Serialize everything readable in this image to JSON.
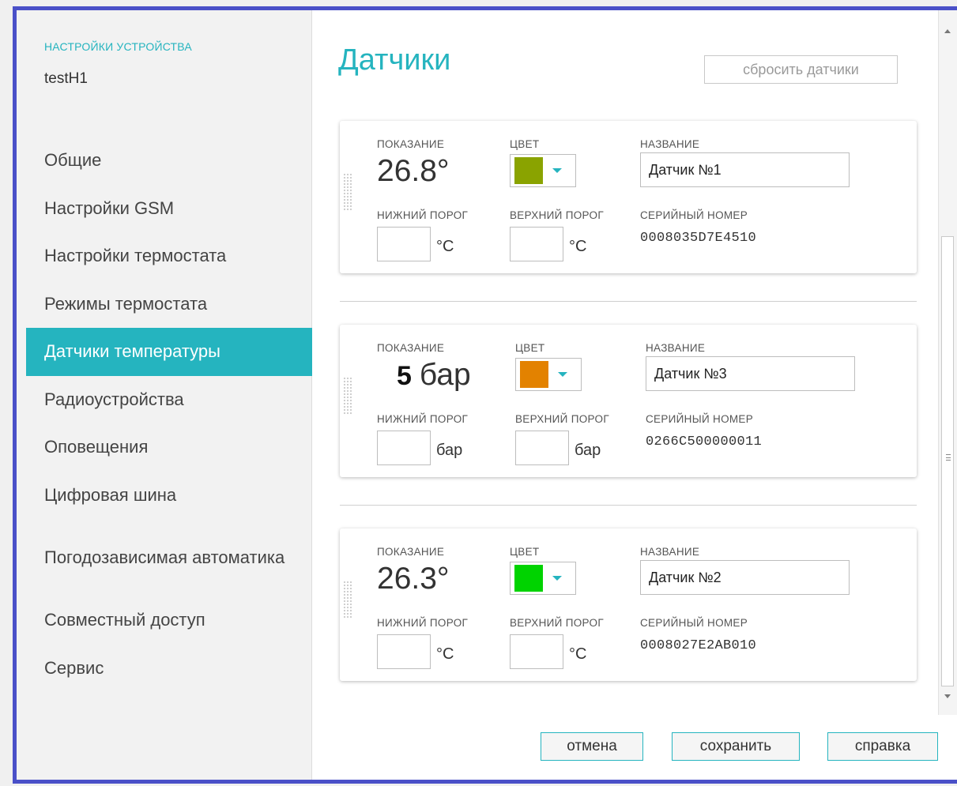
{
  "sidebar": {
    "section_label": "НАСТРОЙКИ УСТРОЙСТВА",
    "device_name": "testH1",
    "items": [
      {
        "label": "Общие"
      },
      {
        "label": "Настройки GSM"
      },
      {
        "label": "Настройки термостата"
      },
      {
        "label": "Режимы термостата"
      },
      {
        "label": "Датчики температуры",
        "active": true
      },
      {
        "label": "Радиоустройства"
      },
      {
        "label": "Оповещения"
      },
      {
        "label": "Цифровая шина"
      },
      {
        "label": "Погодозависимая автоматика"
      },
      {
        "label": "Совместный доступ"
      },
      {
        "label": "Сервис"
      }
    ]
  },
  "main": {
    "title": "Датчики",
    "reset_button": "сбросить датчики"
  },
  "labels": {
    "reading": "ПОКАЗАНИЕ",
    "color": "ЦВЕТ",
    "name": "НАЗВАНИЕ",
    "low": "НИЖНИЙ ПОРОГ",
    "high": "ВЕРХНИЙ ПОРОГ",
    "serial": "СЕРИЙНЫЙ НОМЕР"
  },
  "sensors": [
    {
      "reading": "26.8°",
      "color": "#8aa300",
      "name": "Датчик №1",
      "unit": "°C",
      "serial": "0008035D7E4510",
      "low": "",
      "high": ""
    },
    {
      "reading_value": "5",
      "reading_unit": "бар",
      "color": "#e38200",
      "name": "Датчик №3",
      "unit": "бар",
      "serial": "0266C500000011",
      "low": "",
      "high": ""
    },
    {
      "reading": "26.3°",
      "color": "#00d300",
      "name": "Датчик №2",
      "unit": "°C",
      "serial": "0008027E2AB010",
      "low": "",
      "high": ""
    }
  ],
  "footer": {
    "cancel": "отмена",
    "save": "сохранить",
    "help": "справка"
  },
  "icons": [
    "drag-handle-icon",
    "chevron-down-icon",
    "scroll-up-icon",
    "scroll-down-icon"
  ],
  "accent_color": "#25b4bf"
}
